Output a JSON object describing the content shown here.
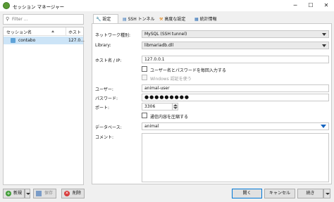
{
  "window": {
    "title": "セッション マネージャー",
    "minimize_glyph": "─",
    "maximize_glyph": "☐",
    "close_glyph": "✕"
  },
  "sidebar": {
    "filter_placeholder": "Filter ...",
    "columns": [
      "セッション名",
      "ホスト"
    ],
    "sessions": [
      {
        "name": "contabo",
        "host": "127.0..."
      }
    ]
  },
  "tabs": [
    {
      "label": "設定",
      "icon": "wrench-icon",
      "active": true
    },
    {
      "label": "SSH トンネル",
      "icon": "tunnel-icon",
      "active": false
    },
    {
      "label": "高度な設定",
      "icon": "wrench-orange-icon",
      "active": false
    },
    {
      "label": "統計情報",
      "icon": "chart-icon",
      "active": false
    }
  ],
  "settings": {
    "network_type_label": "ネットワーク種別:",
    "network_type_value": "MySQL (SSH tunnel)",
    "library_label": "Library:",
    "library_value": "libmariadb.dll",
    "host_label": "ホスト名 / IP:",
    "host_value": "127.0.0.1",
    "prompt_credentials_label": "ユーザー名とパスワードを毎回入力する",
    "windows_auth_label": "Windows 認証を使う",
    "user_label": "ユーザー:",
    "user_value": "animal-user",
    "password_label": "パスワード:",
    "password_value": "●●●●●●●●●",
    "port_label": "ポート:",
    "port_value": "3306",
    "compress_label": "通信内容を圧縮する",
    "database_label": "データベース:",
    "database_value": "animal",
    "comment_label": "コメント:",
    "comment_value": ""
  },
  "bottom": {
    "new_label": "新規",
    "save_label": "保存",
    "delete_label": "削除",
    "open_label": "開く",
    "cancel_label": "キャンセル",
    "more_label": "続き"
  }
}
